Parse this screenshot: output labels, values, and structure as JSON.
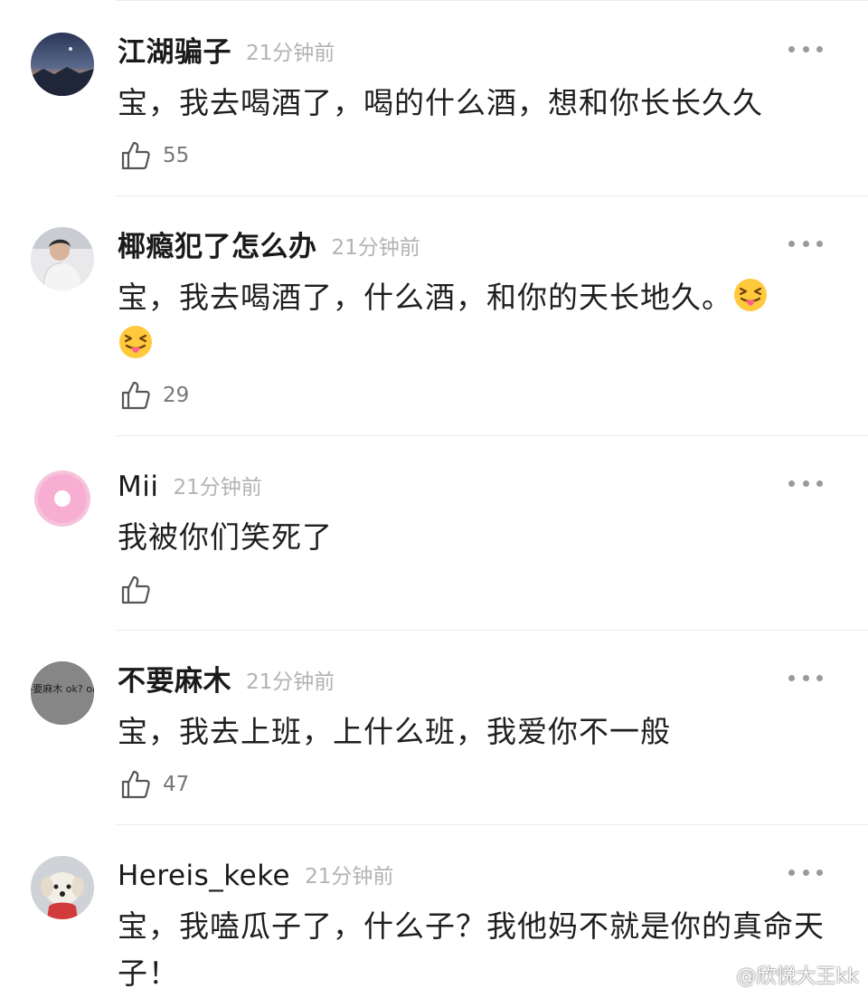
{
  "comments": [
    {
      "username": "江湖骗子",
      "time": "21分钟前",
      "text": "宝，我去喝酒了，喝的什么酒，想和你长长久久",
      "likes": "55",
      "avatar": "night-sky-landscape"
    },
    {
      "username": "椰瘾犯了怎么办",
      "time": "21分钟前",
      "text": "宝，我去喝酒了，什么酒，和你的天长地久。",
      "emoji": "squinting-face-with-tongue",
      "likes": "29",
      "avatar": "person-photo"
    },
    {
      "username": "Mii",
      "time": "21分钟前",
      "text": "我被你们笑死了",
      "likes": "",
      "avatar": "pink-donut"
    },
    {
      "username": "不要麻木",
      "time": "21分钟前",
      "text": "宝，我去上班，上什么班，我爱你不一般",
      "likes": "47",
      "avatar": "handwritten-text-grey",
      "avatar_text": "不要麻木 ok? ok!"
    },
    {
      "username": "Hereis_keke",
      "time": "21分钟前",
      "text": "宝，我嗑瓜子了，什么子？我他妈不就是你的真命天子！",
      "avatar": "white-puppy"
    }
  ],
  "watermark": "@欣悦大王kk",
  "icons": {
    "like": "thumbs-up-icon",
    "more": "ellipsis-icon",
    "watermark": "weibo-logo-icon"
  },
  "colors": {
    "username": "#1a1a1a",
    "time": "#b3b3b3",
    "divider": "#ececec",
    "more_dots": "#9a9a9a"
  }
}
